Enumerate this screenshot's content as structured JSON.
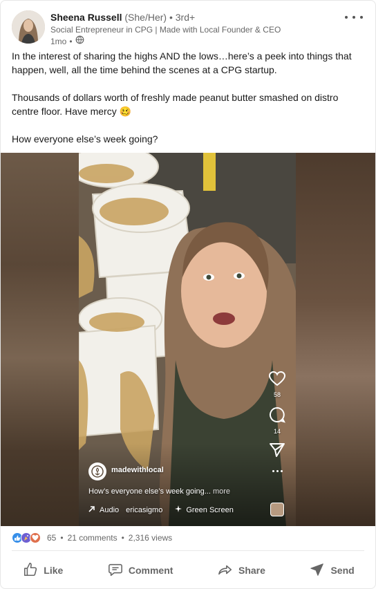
{
  "post": {
    "author": {
      "name": "Sheena Russell",
      "pronouns": "(She/Her)",
      "separator": "•",
      "degree": "3rd+",
      "headline": "Social Entrepreneur in CPG | Made with Local Founder & CEO",
      "time": "1mo",
      "visibility_icon": "globe-icon"
    },
    "text": {
      "p1": "In the interest of sharing the highs AND the lows…here’s a peek into things that happen, well, all the time behind the scenes at a CPG startup.",
      "p2": "Thousands of dollars worth of freshly made peanut butter smashed on distro centre floor. Have mercy 🥴",
      "p3": "How everyone else’s week going?"
    },
    "video": {
      "account": "madewithlocal",
      "caption": "How’s everyone else’s week going...",
      "caption_more": "more",
      "audio_label": "Audio",
      "audio_user": "ericasigmo",
      "effect": "Green Screen",
      "likes": "58",
      "comments": "14"
    },
    "social": {
      "reactions_count": "65",
      "comments": "21 comments",
      "views": "2,316 views",
      "separator": "•"
    },
    "actions": {
      "like": "Like",
      "comment": "Comment",
      "share": "Share",
      "send": "Send"
    },
    "colors": {
      "like_blue": "#378fe9",
      "celebrate": "#6e5fd3",
      "love_red": "#df704d",
      "text_secondary": "#666666"
    }
  }
}
